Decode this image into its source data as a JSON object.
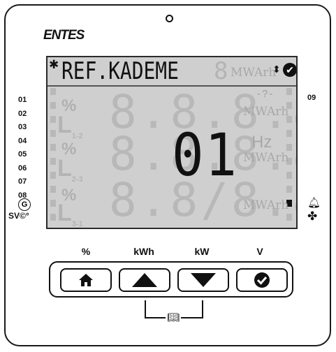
{
  "brand": {
    "logo_text": "ENTES"
  },
  "display": {
    "top_text": "REF.KADEME",
    "top_ghost": "8",
    "mwarh_top": "MWArh",
    "sort_icon": "up-down-arrows-icon",
    "ok_icon": "check-circle-icon",
    "main_value": "01",
    "ghost_digits_row1": "8.8.8.8",
    "ghost_digits_row2": "8.8.8.8",
    "ghost_digits_row3": "8.8/8.8",
    "percent_ghost": "%",
    "phase1": "L",
    "phase1_sub": "1-2",
    "phase2": "L",
    "phase2_sub": "2-3",
    "phase3": "L",
    "phase3_sub": "3-1",
    "hz_label": "Hz",
    "mwarh_row1": "MWArh",
    "mwarh_row2": "MWArh",
    "mwarh_row3": "MWArh",
    "small_ghost": "-?-"
  },
  "steps": {
    "left": [
      "01",
      "02",
      "03",
      "04",
      "05",
      "06",
      "07",
      "08"
    ],
    "right": "09"
  },
  "status": {
    "generator_label": "G",
    "svc_label": "SV©°",
    "alarm_icon": "bell-icon",
    "fan_icon": "fan-icon"
  },
  "buttons": {
    "labels": [
      "%",
      "kWh",
      "kW",
      "V"
    ],
    "home_icon": "home-icon",
    "up_icon": "up-arrow-icon",
    "down_icon": "down-arrow-icon",
    "ok_icon": "check-circle-icon",
    "manual_icon": "book-icon"
  }
}
